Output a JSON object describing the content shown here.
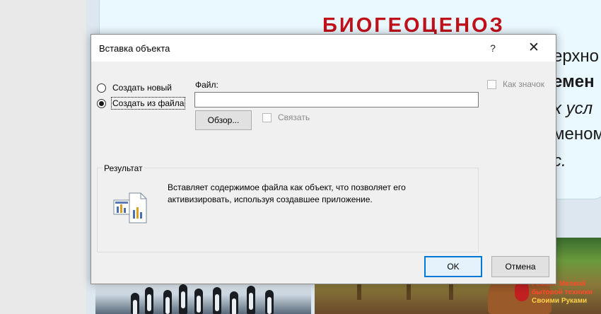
{
  "background_slide": {
    "title": "БИОГЕОЦЕНОЗ",
    "lines": [
      "ерхно",
      "емен",
      "х усл",
      "меном",
      "с."
    ],
    "watermark": [
      "Ремонт Мелкой",
      "бытовой техники",
      "Своими Руками"
    ]
  },
  "dialog": {
    "title": "Вставка объекта",
    "help_glyph": "?",
    "close_glyph": "✕",
    "options": {
      "create_new": "Создать новый",
      "create_from_file": "Создать из файла",
      "selected": "create_from_file"
    },
    "file": {
      "label": "Файл:",
      "value": "",
      "browse_label": "Обзор...",
      "link_label": "Связать",
      "link_checked": false
    },
    "display_as_icon": {
      "label": "Как значок",
      "checked": false
    },
    "result": {
      "legend": "Результат",
      "description": "Вставляет содержимое файла как объект, что позволяет его активизировать, используя создавшее приложение."
    },
    "ok_label": "OK",
    "cancel_label": "Отмена"
  },
  "colors": {
    "accent": "#0078d7",
    "slide_title": "#c0101a",
    "dialog_bg": "#f0f0f0"
  }
}
